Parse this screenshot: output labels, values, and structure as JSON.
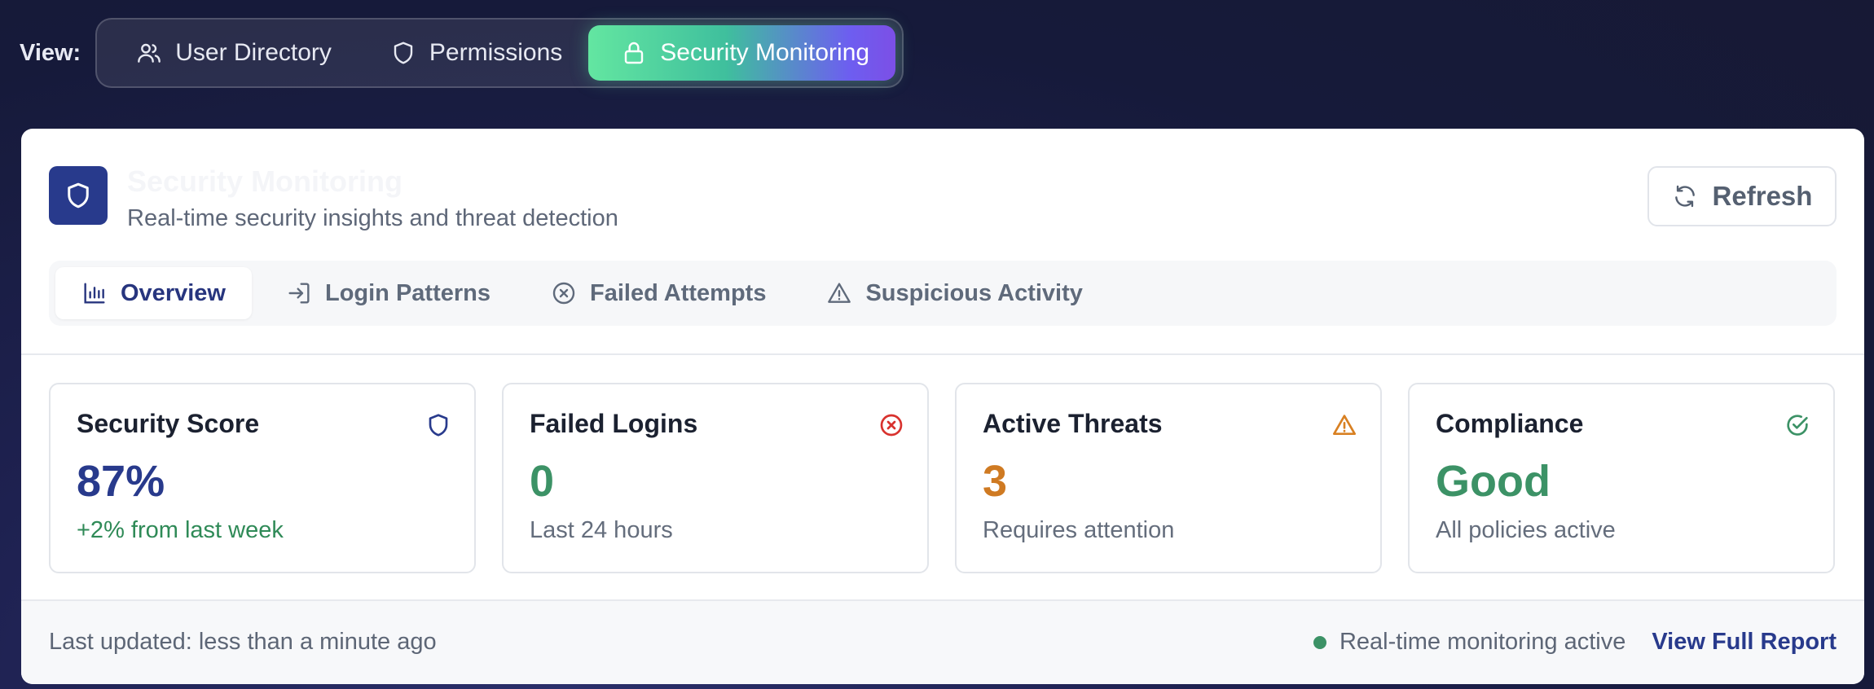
{
  "view_bar": {
    "label": "View:",
    "options": [
      {
        "label": "User Directory",
        "icon": "users-icon",
        "active": false
      },
      {
        "label": "Permissions",
        "icon": "shield-icon",
        "active": false
      },
      {
        "label": "Security Monitoring",
        "icon": "lock-icon",
        "active": true
      }
    ]
  },
  "header": {
    "title": "Security Monitoring",
    "subtitle": "Real-time security insights and threat detection",
    "refresh_label": "Refresh"
  },
  "tabs": [
    {
      "label": "Overview",
      "icon": "bar-chart-icon",
      "active": true
    },
    {
      "label": "Login Patterns",
      "icon": "login-icon",
      "active": false
    },
    {
      "label": "Failed Attempts",
      "icon": "x-circle-icon",
      "active": false
    },
    {
      "label": "Suspicious Activity",
      "icon": "alert-triangle-icon",
      "active": false
    }
  ],
  "stats": [
    {
      "label": "Security Score",
      "value": "87%",
      "note": "+2% from last week",
      "icon": "shield-icon",
      "value_color": "#283a8c",
      "note_color": "#2f8a57",
      "icon_color": "#283a8c"
    },
    {
      "label": "Failed Logins",
      "value": "0",
      "note": "Last 24 hours",
      "icon": "x-circle-icon",
      "value_color": "#3c9266",
      "note_color": "#646d7c",
      "icon_color": "#d8322e"
    },
    {
      "label": "Active Threats",
      "value": "3",
      "note": "Requires attention",
      "icon": "alert-triangle-icon",
      "value_color": "#cf7a22",
      "note_color": "#646d7c",
      "icon_color": "#d88022"
    },
    {
      "label": "Compliance",
      "value": "Good",
      "note": "All policies active",
      "icon": "check-circle-icon",
      "value_color": "#3c9266",
      "note_color": "#646d7c",
      "icon_color": "#3c9266"
    }
  ],
  "footer": {
    "last_updated": "Last updated: less than a minute ago",
    "status_text": "Real-time monitoring active",
    "report_link": "View Full Report"
  },
  "colors": {
    "brand": "#283a8c",
    "success": "#3c9266",
    "warning": "#cf7a22",
    "danger": "#d8322e"
  }
}
